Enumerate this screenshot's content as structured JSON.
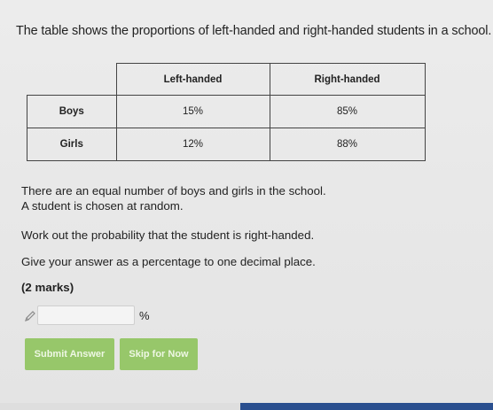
{
  "question": {
    "intro": "The table shows the proportions of left-handed and right-handed students in a school."
  },
  "table": {
    "headers": [
      "",
      "Left-handed",
      "Right-handed"
    ],
    "rows": [
      {
        "label": "Boys",
        "left": "15%",
        "right": "85%"
      },
      {
        "label": "Girls",
        "left": "12%",
        "right": "88%"
      }
    ]
  },
  "body": {
    "line1": "There are an equal number of boys and girls in the school.",
    "line2": "A student is chosen at random.",
    "line3": "Work out the probability that the student is right-handed.",
    "line4": "Give your answer as a percentage to one decimal place.",
    "marks": "(2 marks)"
  },
  "answer": {
    "value": "",
    "unit": "%"
  },
  "buttons": {
    "submit_label": "Submit Answer",
    "skip_label": "Skip for Now"
  },
  "colors": {
    "button_green": "#97c76a",
    "taskbar_blue": "#2a4f8f"
  }
}
